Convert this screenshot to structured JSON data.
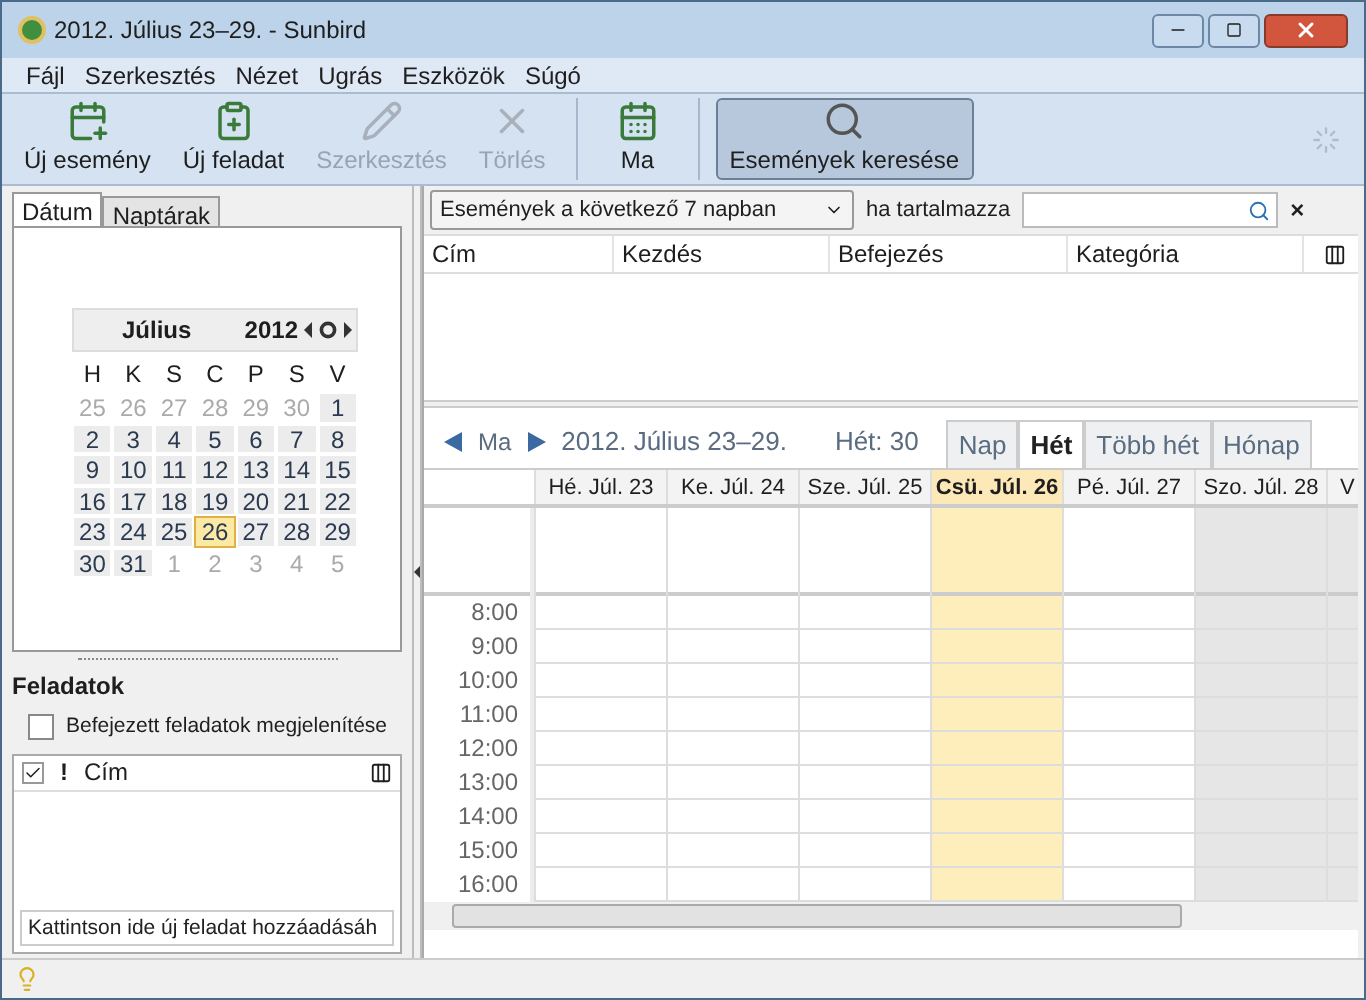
{
  "window": {
    "title": "2012. Július 23–29. - Sunbird"
  },
  "menu": [
    "Fájl",
    "Szerkesztés",
    "Nézet",
    "Ugrás",
    "Eszközök",
    "Súgó"
  ],
  "toolbar": [
    {
      "kind": "new-event",
      "label": "Új esemény",
      "disabled": false,
      "pressed": false
    },
    {
      "kind": "new-task",
      "label": "Új feladat",
      "disabled": false,
      "pressed": false
    },
    {
      "kind": "edit",
      "label": "Szerkesztés",
      "disabled": true,
      "pressed": false
    },
    {
      "kind": "delete",
      "label": "Törlés",
      "disabled": true,
      "pressed": false
    },
    {
      "kind": "today",
      "label": "Ma",
      "disabled": false,
      "pressed": false
    },
    {
      "kind": "search",
      "label": "Események keresése",
      "disabled": false,
      "pressed": true
    }
  ],
  "sidebar_tabs": [
    {
      "label": "Dátum",
      "selected": true
    },
    {
      "label": "Naptárak",
      "selected": false
    }
  ],
  "minical": {
    "month": "Július",
    "year": "2012",
    "weekdays": [
      "H",
      "K",
      "S",
      "C",
      "P",
      "S",
      "V"
    ],
    "days": [
      {
        "label": "25",
        "muted": true,
        "selected": false
      },
      {
        "label": "26",
        "muted": true,
        "selected": false
      },
      {
        "label": "27",
        "muted": true,
        "selected": false
      },
      {
        "label": "28",
        "muted": true,
        "selected": false
      },
      {
        "label": "29",
        "muted": true,
        "selected": false
      },
      {
        "label": "30",
        "muted": true,
        "selected": false
      },
      {
        "label": "1",
        "muted": false,
        "selected": false
      },
      {
        "label": "2",
        "muted": false,
        "selected": false
      },
      {
        "label": "3",
        "muted": false,
        "selected": false
      },
      {
        "label": "4",
        "muted": false,
        "selected": false
      },
      {
        "label": "5",
        "muted": false,
        "selected": false
      },
      {
        "label": "6",
        "muted": false,
        "selected": false
      },
      {
        "label": "7",
        "muted": false,
        "selected": false
      },
      {
        "label": "8",
        "muted": false,
        "selected": false
      },
      {
        "label": "9",
        "muted": false,
        "selected": false
      },
      {
        "label": "10",
        "muted": false,
        "selected": false
      },
      {
        "label": "11",
        "muted": false,
        "selected": false
      },
      {
        "label": "12",
        "muted": false,
        "selected": false
      },
      {
        "label": "13",
        "muted": false,
        "selected": false
      },
      {
        "label": "14",
        "muted": false,
        "selected": false
      },
      {
        "label": "15",
        "muted": false,
        "selected": false
      },
      {
        "label": "16",
        "muted": false,
        "selected": false
      },
      {
        "label": "17",
        "muted": false,
        "selected": false
      },
      {
        "label": "18",
        "muted": false,
        "selected": false
      },
      {
        "label": "19",
        "muted": false,
        "selected": false
      },
      {
        "label": "20",
        "muted": false,
        "selected": false
      },
      {
        "label": "21",
        "muted": false,
        "selected": false
      },
      {
        "label": "22",
        "muted": false,
        "selected": false
      },
      {
        "label": "23",
        "muted": false,
        "selected": false
      },
      {
        "label": "24",
        "muted": false,
        "selected": false
      },
      {
        "label": "25",
        "muted": false,
        "selected": false
      },
      {
        "label": "26",
        "muted": false,
        "selected": true
      },
      {
        "label": "27",
        "muted": false,
        "selected": false
      },
      {
        "label": "28",
        "muted": false,
        "selected": false
      },
      {
        "label": "29",
        "muted": false,
        "selected": false
      },
      {
        "label": "30",
        "muted": false,
        "selected": false
      },
      {
        "label": "31",
        "muted": false,
        "selected": false
      },
      {
        "label": "1",
        "muted": true,
        "selected": false
      },
      {
        "label": "2",
        "muted": true,
        "selected": false
      },
      {
        "label": "3",
        "muted": true,
        "selected": false
      },
      {
        "label": "4",
        "muted": true,
        "selected": false
      },
      {
        "label": "5",
        "muted": true,
        "selected": false
      }
    ]
  },
  "tasks": {
    "title": "Feladatok",
    "show_completed": {
      "label": "Befejezett feladatok megjelenítése",
      "checked": false
    },
    "columns": [
      "!",
      "Cím"
    ],
    "new_task": {
      "placeholder": "Kattintson ide új feladat hozzáadásáh"
    }
  },
  "filter": {
    "range": "Események a következő 7 napban",
    "contains_label": "ha tartalmazza",
    "close": "×"
  },
  "event_list": {
    "columns": [
      "Cím",
      "Kezdés",
      "Befejezés",
      "Kategória"
    ]
  },
  "view_nav": {
    "today": "Ma",
    "range": "2012. Július 23–29.",
    "week": "Hét: 30"
  },
  "view_tabs": [
    {
      "label": "Nap",
      "selected": false
    },
    {
      "label": "Hét",
      "selected": true
    },
    {
      "label": "Több hét",
      "selected": false
    },
    {
      "label": "Hónap",
      "selected": false
    }
  ],
  "days": [
    {
      "label": "Hé. Júl. 23",
      "selected": false,
      "weekend": false
    },
    {
      "label": "Ke. Júl. 24",
      "selected": false,
      "weekend": false
    },
    {
      "label": "Sze. Júl. 25",
      "selected": false,
      "weekend": false
    },
    {
      "label": "Csü. Júl. 26",
      "selected": true,
      "weekend": false
    },
    {
      "label": "Pé. Júl. 27",
      "selected": false,
      "weekend": false
    },
    {
      "label": "Szo. Júl. 28",
      "selected": false,
      "weekend": true
    },
    {
      "label": "V",
      "selected": false,
      "weekend": true
    }
  ],
  "hours": [
    "8:00",
    "9:00",
    "10:00",
    "11:00",
    "12:00",
    "13:00",
    "14:00",
    "15:00",
    "16:00"
  ]
}
